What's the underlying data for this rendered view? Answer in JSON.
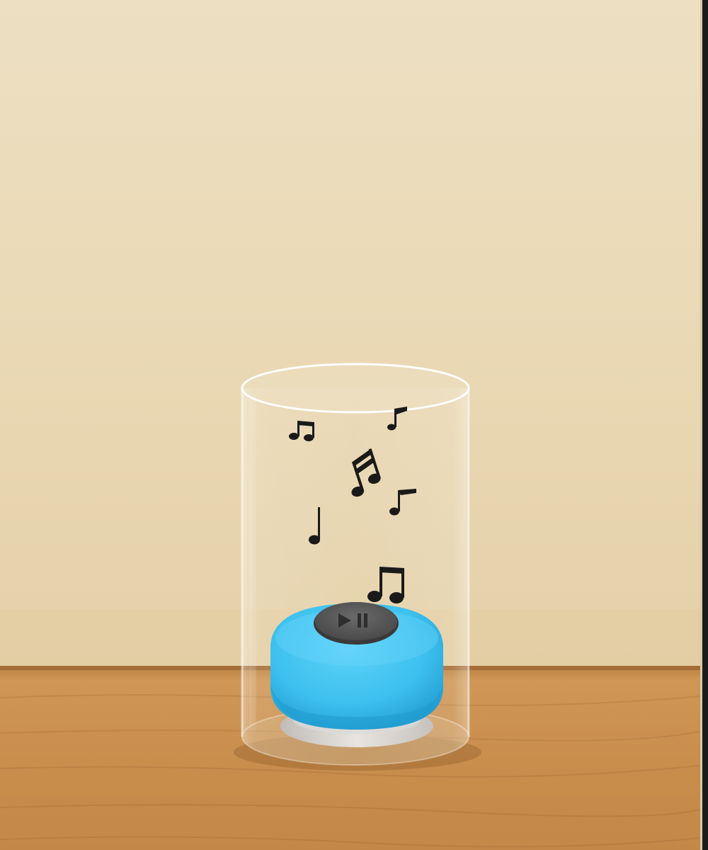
{
  "scene": {
    "subject": "cylinder-glass",
    "speaker": {
      "button": "play-pause-icon"
    },
    "notes": [
      "beamed-eighth-notes-icon",
      "eighth-note-icon",
      "beamed-sixteenth-notes-icon",
      "eighth-note-icon",
      "quarter-note-icon",
      "beamed-eighth-notes-icon"
    ],
    "colors": {
      "wall_top": "#ebddbd",
      "wall_bottom": "#e6d3ad",
      "table": "#c98f4c",
      "table_edge": "#a8703a",
      "speaker": "#3ec2ee",
      "speaker_dark": "#1f99cf",
      "button": "#5b5b5b",
      "notes": "#1a1a1a"
    }
  }
}
